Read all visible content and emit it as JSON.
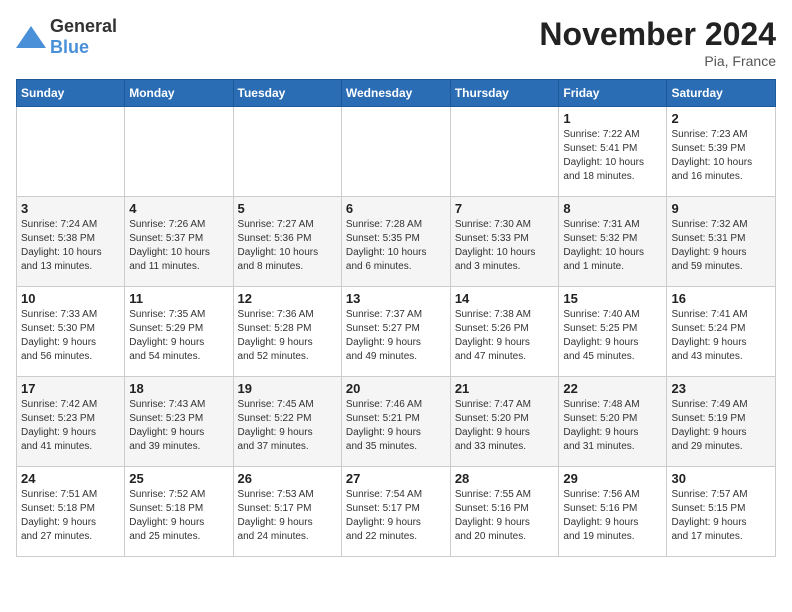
{
  "header": {
    "logo_general": "General",
    "logo_blue": "Blue",
    "month_title": "November 2024",
    "location": "Pia, France"
  },
  "weekdays": [
    "Sunday",
    "Monday",
    "Tuesday",
    "Wednesday",
    "Thursday",
    "Friday",
    "Saturday"
  ],
  "weeks": [
    [
      {
        "day": "",
        "info": ""
      },
      {
        "day": "",
        "info": ""
      },
      {
        "day": "",
        "info": ""
      },
      {
        "day": "",
        "info": ""
      },
      {
        "day": "",
        "info": ""
      },
      {
        "day": "1",
        "info": "Sunrise: 7:22 AM\nSunset: 5:41 PM\nDaylight: 10 hours\nand 18 minutes."
      },
      {
        "day": "2",
        "info": "Sunrise: 7:23 AM\nSunset: 5:39 PM\nDaylight: 10 hours\nand 16 minutes."
      }
    ],
    [
      {
        "day": "3",
        "info": "Sunrise: 7:24 AM\nSunset: 5:38 PM\nDaylight: 10 hours\nand 13 minutes."
      },
      {
        "day": "4",
        "info": "Sunrise: 7:26 AM\nSunset: 5:37 PM\nDaylight: 10 hours\nand 11 minutes."
      },
      {
        "day": "5",
        "info": "Sunrise: 7:27 AM\nSunset: 5:36 PM\nDaylight: 10 hours\nand 8 minutes."
      },
      {
        "day": "6",
        "info": "Sunrise: 7:28 AM\nSunset: 5:35 PM\nDaylight: 10 hours\nand 6 minutes."
      },
      {
        "day": "7",
        "info": "Sunrise: 7:30 AM\nSunset: 5:33 PM\nDaylight: 10 hours\nand 3 minutes."
      },
      {
        "day": "8",
        "info": "Sunrise: 7:31 AM\nSunset: 5:32 PM\nDaylight: 10 hours\nand 1 minute."
      },
      {
        "day": "9",
        "info": "Sunrise: 7:32 AM\nSunset: 5:31 PM\nDaylight: 9 hours\nand 59 minutes."
      }
    ],
    [
      {
        "day": "10",
        "info": "Sunrise: 7:33 AM\nSunset: 5:30 PM\nDaylight: 9 hours\nand 56 minutes."
      },
      {
        "day": "11",
        "info": "Sunrise: 7:35 AM\nSunset: 5:29 PM\nDaylight: 9 hours\nand 54 minutes."
      },
      {
        "day": "12",
        "info": "Sunrise: 7:36 AM\nSunset: 5:28 PM\nDaylight: 9 hours\nand 52 minutes."
      },
      {
        "day": "13",
        "info": "Sunrise: 7:37 AM\nSunset: 5:27 PM\nDaylight: 9 hours\nand 49 minutes."
      },
      {
        "day": "14",
        "info": "Sunrise: 7:38 AM\nSunset: 5:26 PM\nDaylight: 9 hours\nand 47 minutes."
      },
      {
        "day": "15",
        "info": "Sunrise: 7:40 AM\nSunset: 5:25 PM\nDaylight: 9 hours\nand 45 minutes."
      },
      {
        "day": "16",
        "info": "Sunrise: 7:41 AM\nSunset: 5:24 PM\nDaylight: 9 hours\nand 43 minutes."
      }
    ],
    [
      {
        "day": "17",
        "info": "Sunrise: 7:42 AM\nSunset: 5:23 PM\nDaylight: 9 hours\nand 41 minutes."
      },
      {
        "day": "18",
        "info": "Sunrise: 7:43 AM\nSunset: 5:23 PM\nDaylight: 9 hours\nand 39 minutes."
      },
      {
        "day": "19",
        "info": "Sunrise: 7:45 AM\nSunset: 5:22 PM\nDaylight: 9 hours\nand 37 minutes."
      },
      {
        "day": "20",
        "info": "Sunrise: 7:46 AM\nSunset: 5:21 PM\nDaylight: 9 hours\nand 35 minutes."
      },
      {
        "day": "21",
        "info": "Sunrise: 7:47 AM\nSunset: 5:20 PM\nDaylight: 9 hours\nand 33 minutes."
      },
      {
        "day": "22",
        "info": "Sunrise: 7:48 AM\nSunset: 5:20 PM\nDaylight: 9 hours\nand 31 minutes."
      },
      {
        "day": "23",
        "info": "Sunrise: 7:49 AM\nSunset: 5:19 PM\nDaylight: 9 hours\nand 29 minutes."
      }
    ],
    [
      {
        "day": "24",
        "info": "Sunrise: 7:51 AM\nSunset: 5:18 PM\nDaylight: 9 hours\nand 27 minutes."
      },
      {
        "day": "25",
        "info": "Sunrise: 7:52 AM\nSunset: 5:18 PM\nDaylight: 9 hours\nand 25 minutes."
      },
      {
        "day": "26",
        "info": "Sunrise: 7:53 AM\nSunset: 5:17 PM\nDaylight: 9 hours\nand 24 minutes."
      },
      {
        "day": "27",
        "info": "Sunrise: 7:54 AM\nSunset: 5:17 PM\nDaylight: 9 hours\nand 22 minutes."
      },
      {
        "day": "28",
        "info": "Sunrise: 7:55 AM\nSunset: 5:16 PM\nDaylight: 9 hours\nand 20 minutes."
      },
      {
        "day": "29",
        "info": "Sunrise: 7:56 AM\nSunset: 5:16 PM\nDaylight: 9 hours\nand 19 minutes."
      },
      {
        "day": "30",
        "info": "Sunrise: 7:57 AM\nSunset: 5:15 PM\nDaylight: 9 hours\nand 17 minutes."
      }
    ]
  ]
}
